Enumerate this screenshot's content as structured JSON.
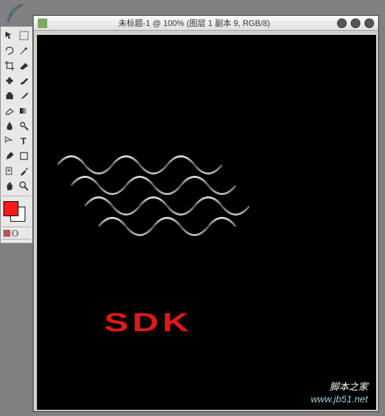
{
  "feather": {
    "name": "app-feather-icon"
  },
  "toolbox": {
    "tools": [
      "move",
      "marquee",
      "lasso",
      "wand",
      "crop",
      "slice",
      "healing",
      "brush",
      "clone",
      "history",
      "eraser",
      "gradient",
      "blur",
      "dodge",
      "path",
      "type",
      "pen",
      "shape",
      "notes",
      "eyedropper",
      "hand",
      "zoom"
    ],
    "fg_color": "#ff1a1a",
    "bg_color": "#ffffff"
  },
  "document": {
    "title": "未标题-1 @ 100% (图层 1 副本 9, RGB/8)"
  },
  "canvas": {
    "sdk_label": "SDK",
    "sdk_color": "#e01818"
  },
  "watermark": {
    "text": "脚本之家",
    "url": "www.jb51.net"
  }
}
